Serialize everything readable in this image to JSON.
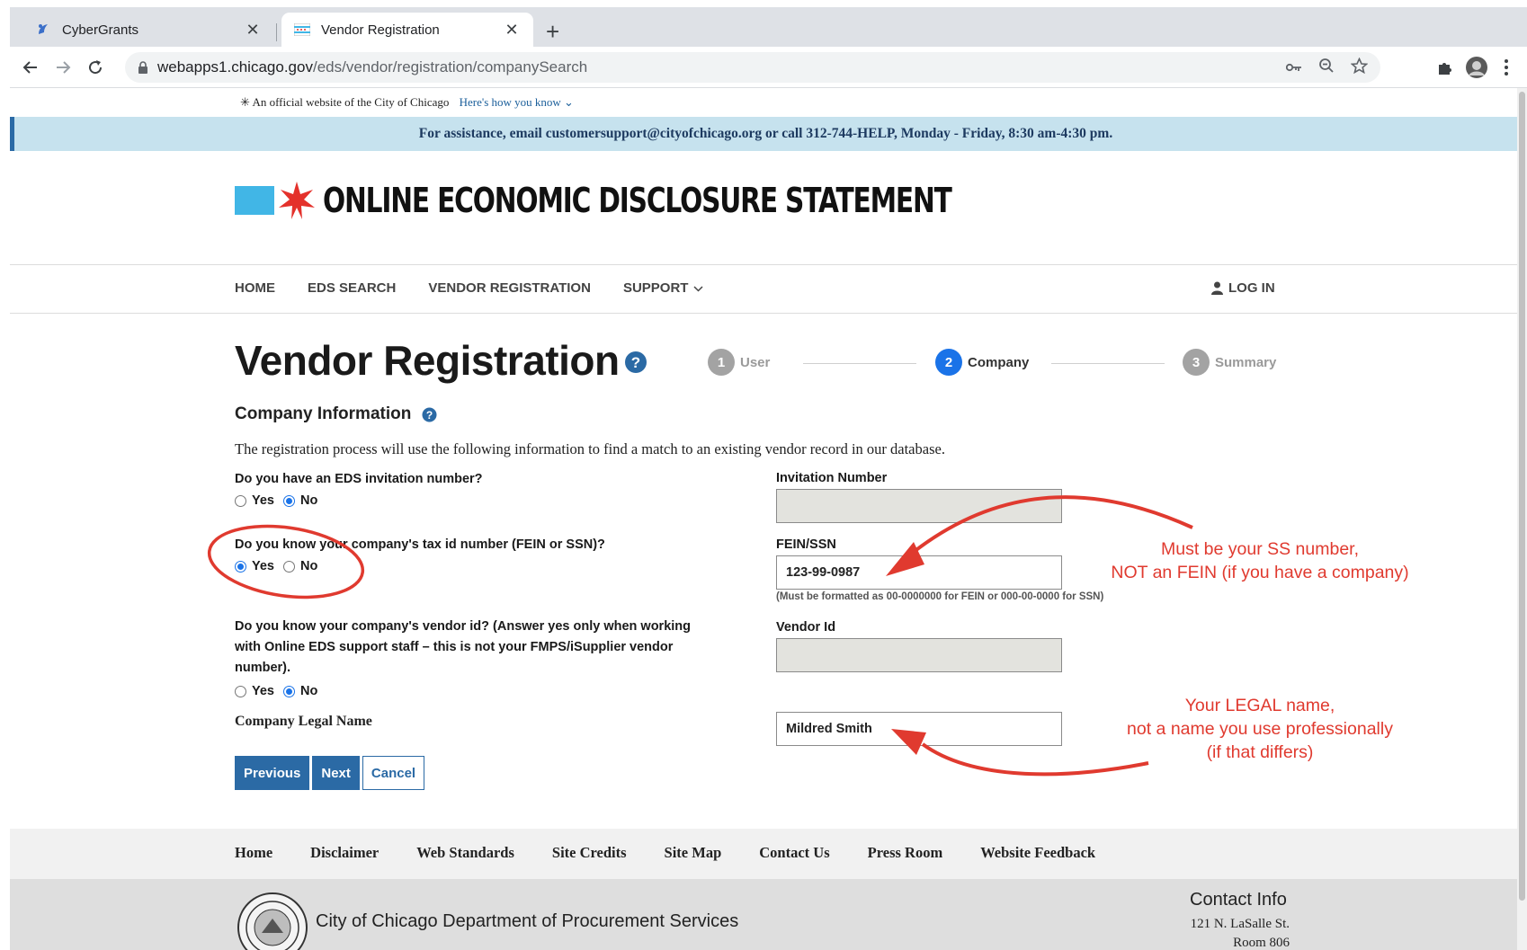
{
  "browser": {
    "tabs": [
      {
        "title": "CyberGrants",
        "active": false
      },
      {
        "title": "Vendor Registration",
        "active": true
      }
    ],
    "close_glyph": "✕",
    "newtab_glyph": "+",
    "url_host": "webapps1.chicago.gov",
    "url_path": "/eds/vendor/registration/companySearch"
  },
  "banner": {
    "official_text": "An official website of the City of Chicago",
    "how_link": "Here's how you know",
    "assistance": "For assistance, email customersupport@cityofchicago.org or call 312-744-HELP, Monday - Friday, 8:30 am-4:30 pm."
  },
  "site": {
    "logo_text": "ONLINE ECONOMIC DISCLOSURE STATEMENT",
    "accent_color": "#41b6e6",
    "star_color": "#e4312b"
  },
  "nav": {
    "items": [
      "HOME",
      "EDS SEARCH",
      "VENDOR REGISTRATION",
      "SUPPORT"
    ],
    "login": "LOG IN"
  },
  "page": {
    "title": "Vendor Registration",
    "steps": [
      {
        "num": "1",
        "label": "User",
        "state": "done"
      },
      {
        "num": "2",
        "label": "Company",
        "state": "current"
      },
      {
        "num": "3",
        "label": "Summary",
        "state": "todo"
      }
    ],
    "section_title": "Company Information",
    "intro": "The registration process will use the following information to find a match to an existing vendor record in our database."
  },
  "form": {
    "q_invitation": "Do you have an EDS invitation number?",
    "q_taxid": "Do you know your company's tax id number (FEIN or SSN)?",
    "q_vendorid_lines": [
      "Do you know your company's vendor id? (Answer yes only when working",
      "with Online EDS support staff – this is not your FMPS/iSupplier vendor",
      "number)."
    ],
    "yes": "Yes",
    "no": "No",
    "answers": {
      "invitation": "No",
      "taxid": "Yes",
      "vendorid": "No"
    },
    "invitation_label": "Invitation Number",
    "invitation_value": "",
    "fein_label": "FEIN/SSN",
    "fein_value": "123-99-0987",
    "fein_hint": "(Must be formatted as 00-0000000 for FEIN or 000-00-0000 for SSN)",
    "vendor_label": "Vendor Id",
    "vendor_value": "",
    "legal_label": "Company Legal Name",
    "legal_value": "Mildred Smith",
    "buttons": {
      "previous": "Previous",
      "next": "Next",
      "cancel": "Cancel"
    }
  },
  "annotations": {
    "color": "#e03a2f",
    "note1_lines": [
      "Must be your SS number,",
      "NOT an FEIN (if you have a company)"
    ],
    "note2_lines": [
      "Your LEGAL name,",
      "not a name you use professionally",
      "(if that differs)"
    ]
  },
  "footer": {
    "links": [
      "Home",
      "Disclaimer",
      "Web Standards",
      "Site Credits",
      "Site Map",
      "Contact Us",
      "Press Room",
      "Website Feedback"
    ],
    "department": "City of Chicago Department of Procurement Services",
    "contact_title": "Contact Info",
    "address_lines": [
      "121 N. LaSalle St.",
      "Room 806"
    ]
  }
}
